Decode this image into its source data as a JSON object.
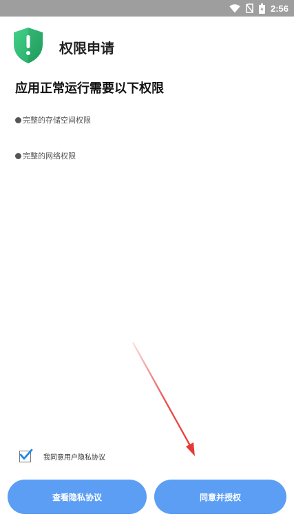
{
  "status_bar": {
    "time": "2:56",
    "icons": [
      "wifi-icon",
      "no-sim-icon",
      "battery-charging-icon"
    ]
  },
  "header": {
    "icon": "shield-alert-icon",
    "title": "权限申请"
  },
  "section_title": "应用正常运行需要以下权限",
  "permissions": [
    {
      "label": "完整的存储空间权限"
    },
    {
      "label": "完整的网络权限"
    }
  ],
  "agreement": {
    "checked": true,
    "label": "我同意用户隐私协议"
  },
  "buttons": {
    "view_privacy": "查看隐私协议",
    "agree_grant": "同意并授权"
  },
  "colors": {
    "status_bar": "#9e9e9e",
    "shield": "#2fbf71",
    "button": "#5b9ef4",
    "check": "#1e88e5",
    "annotation_arrow": "#e53935"
  }
}
